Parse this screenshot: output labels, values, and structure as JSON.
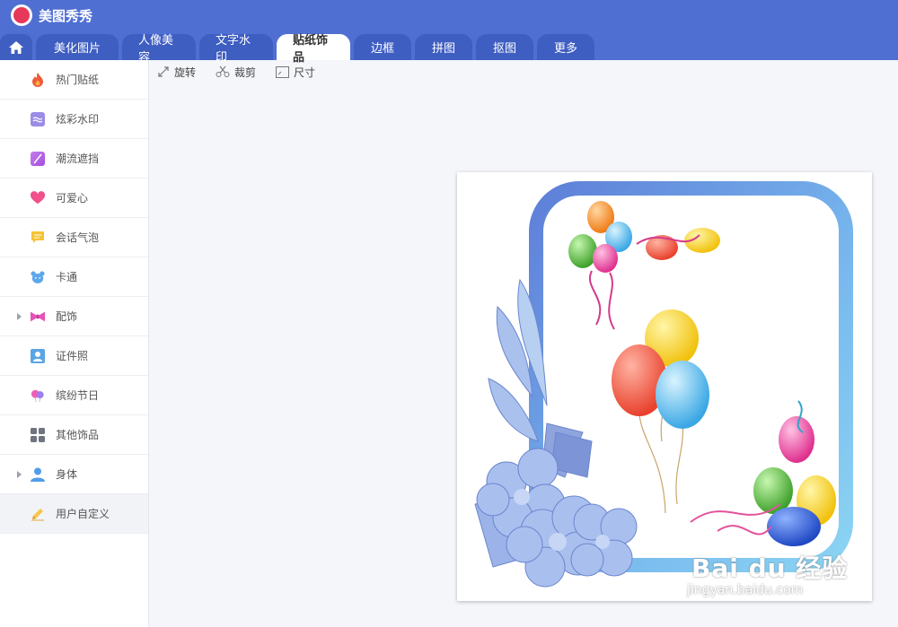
{
  "app": {
    "title": "美图秀秀",
    "accent": "#4f6fd3"
  },
  "tabs": [
    {
      "label": "美化图片"
    },
    {
      "label": "人像美容"
    },
    {
      "label": "文字水印"
    },
    {
      "label": "贴纸饰品",
      "active": true
    },
    {
      "label": "边框"
    },
    {
      "label": "拼图"
    },
    {
      "label": "抠图"
    },
    {
      "label": "更多"
    }
  ],
  "toolbar": {
    "rotate": "旋转",
    "crop": "裁剪",
    "size": "尺寸"
  },
  "sidebar": {
    "items": [
      {
        "label": "热门贴纸",
        "icon": "flame-icon"
      },
      {
        "label": "炫彩水印",
        "icon": "watermark-icon"
      },
      {
        "label": "潮流遮挡",
        "icon": "mask-icon"
      },
      {
        "label": "可爱心",
        "icon": "heart-icon"
      },
      {
        "label": "会话气泡",
        "icon": "speech-bubble-icon"
      },
      {
        "label": "卡通",
        "icon": "bear-icon"
      },
      {
        "label": "配饰",
        "icon": "bow-icon"
      },
      {
        "label": "证件照",
        "icon": "id-photo-icon"
      },
      {
        "label": "缤纷节日",
        "icon": "balloon-icon"
      },
      {
        "label": "其他饰品",
        "icon": "grid-icon"
      },
      {
        "label": "身体",
        "icon": "person-icon"
      },
      {
        "label": "用户自定义",
        "icon": "pencil-icon"
      }
    ]
  },
  "watermark": {
    "main": "Bai du 经验",
    "sub": "jingyan.baidu.com"
  }
}
